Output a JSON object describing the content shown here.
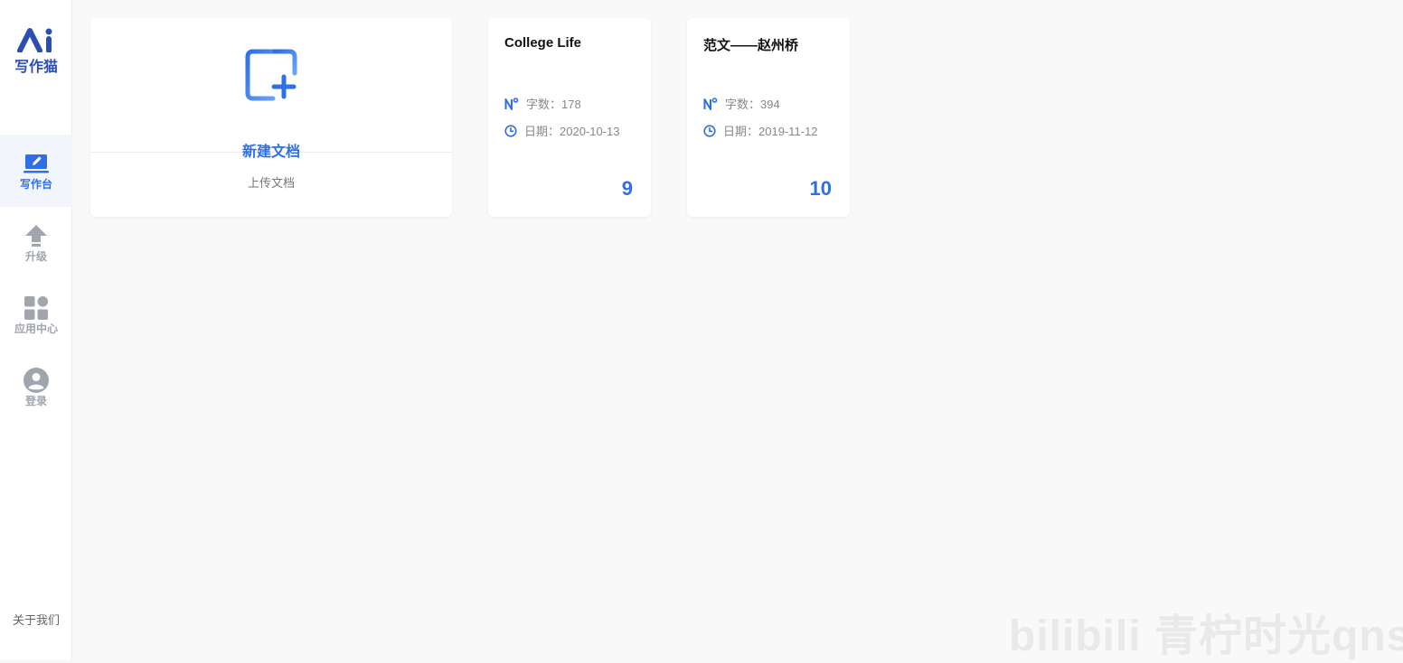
{
  "app": {
    "name": "写作猫"
  },
  "sidebar": {
    "items": [
      {
        "label": "写作台",
        "icon": "edit-laptop-icon",
        "active": true
      },
      {
        "label": "升级",
        "icon": "upgrade-arrow-icon",
        "active": false
      },
      {
        "label": "应用中心",
        "icon": "apps-grid-icon",
        "active": false
      },
      {
        "label": "登录",
        "icon": "user-avatar-icon",
        "active": false
      }
    ],
    "about": "关于我们"
  },
  "new_document": {
    "label": "新建文档",
    "upload_label": "上传文档",
    "icon": "add-document-icon"
  },
  "documents": [
    {
      "title": "College Life",
      "words_text": "字数：178",
      "date_text": "日期：2020-10-13",
      "count": "9"
    },
    {
      "title": "范文——赵州桥",
      "words_text": "字数：394",
      "date_text": "日期：2019-11-12",
      "count": "10"
    }
  ],
  "watermark": "bilibili 青柠时光qnsg",
  "colors": {
    "accent": "#2e6ee6",
    "logo": "#2a4fb0",
    "background": "#f9f9f9",
    "inactive": "#a1a5ae"
  }
}
